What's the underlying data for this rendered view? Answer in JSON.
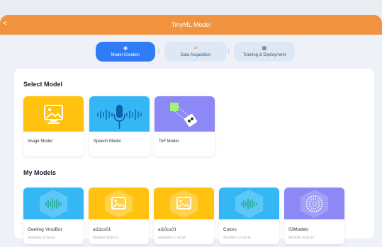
{
  "window": {
    "title": "TinyML Model",
    "back": "<"
  },
  "steps": [
    {
      "label": "Model Creation",
      "icon": "◉"
    },
    {
      "label": "Data Acquisition",
      "icon": "✕"
    },
    {
      "label": "Training & Deployment",
      "icon": "▦"
    }
  ],
  "sections": {
    "select_title": "Select Model",
    "mymodels_title": "My Models"
  },
  "select_models": [
    {
      "label": "Image Model",
      "icon": "image-icon",
      "color": "#ffc20e"
    },
    {
      "label": "Speech Model",
      "icon": "microphone-icon",
      "color": "#35b7f5"
    },
    {
      "label": "ToF Model",
      "icon": "tof-sensor-icon",
      "color": "#8c88f5"
    }
  ],
  "my_models": [
    {
      "name": "Geeting VinciBot",
      "date": "2024/9/11 17:56:04",
      "icon": "waveform-icon",
      "color": "#35b7f5"
    },
    {
      "name": "ai11cs01",
      "date": "2024/8/7 16:53:14",
      "icon": "image-icon",
      "color": "#ffc20e"
    },
    {
      "name": "ai10cs01",
      "date": "2024/5/29 17:30:34",
      "icon": "image-icon",
      "color": "#ffc20e"
    },
    {
      "name": "Colors",
      "date": "2024/5/17 17:22:43",
      "icon": "waveform-icon",
      "color": "#35b7f5"
    },
    {
      "name": "03Models",
      "date": "2024/2/5 15:01:21",
      "icon": "dot-circle-icon",
      "color": "#8c88f5"
    }
  ]
}
